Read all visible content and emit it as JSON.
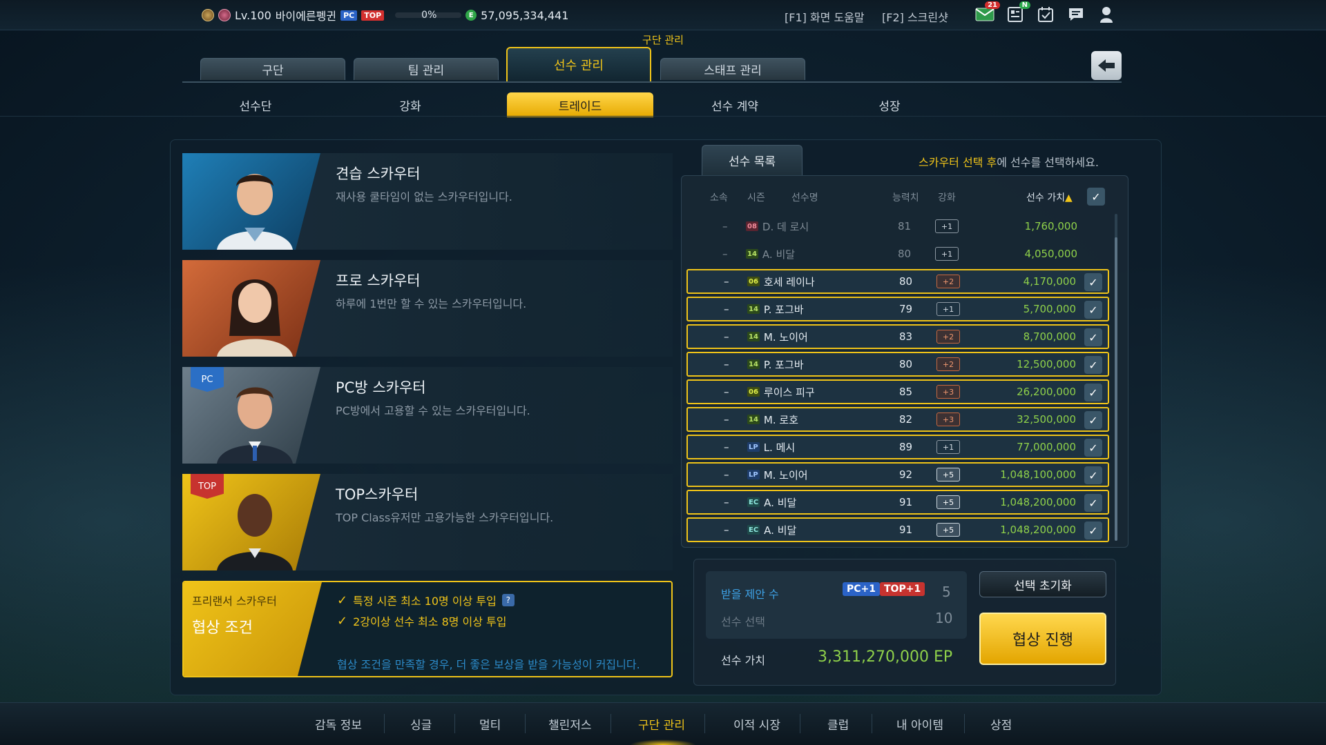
{
  "topbar": {
    "level": "Lv.100",
    "username": "바이에른펭귄",
    "pc_tag": "PC",
    "top_tag": "TOP",
    "exp_percent": "0%",
    "coin_symbol": "E",
    "ep_balance": "57,095,334,441",
    "help": "[F1] 화면 도움말",
    "screenshot": "[F2] 스크린샷",
    "mail_badge": "21",
    "news_badge": "N"
  },
  "header": {
    "section_title": "구단 관리",
    "tabs": [
      {
        "label": "구단"
      },
      {
        "label": "팀 관리"
      },
      {
        "label": "선수 관리"
      },
      {
        "label": "스태프 관리"
      }
    ],
    "active_tab": "선수 관리",
    "subtabs": [
      {
        "label": "선수단"
      },
      {
        "label": "강화"
      },
      {
        "label": "트레이드"
      },
      {
        "label": "선수 계약"
      },
      {
        "label": "성장"
      }
    ],
    "active_subtab": "트레이드"
  },
  "scouts": [
    {
      "name": "견습 스카우터",
      "desc": "재사용 쿨타임이 없는 스카우터입니다.",
      "badge": ""
    },
    {
      "name": "프로 스카우터",
      "desc": "하루에 1번만 할 수 있는 스카우터입니다.",
      "badge": ""
    },
    {
      "name": "PC방 스카우터",
      "desc": "PC방에서 고용할 수 있는 스카우터입니다.",
      "badge": "PC"
    },
    {
      "name": "TOP스카우터",
      "desc": "TOP Class유저만 고용가능한 스카우터입니다.",
      "badge": "TOP"
    }
  ],
  "conditions": {
    "subtitle": "프리랜서 스카우터",
    "title": "협상 조건",
    "items": [
      "특정 시즌 최소 10명 이상 투입",
      "2강이상 선수 최소 8명 이상 투입"
    ],
    "help_icon": "?",
    "note": "협상 조건을 만족할 경우, 더 좋은 보상을 받을 가능성이 커집니다."
  },
  "player_list": {
    "tab": "선수 목록",
    "hint_highlight": "스카우터 선택 후",
    "hint_rest": "에 선수를 선택하세요.",
    "columns": {
      "club": "소속",
      "season": "시즌",
      "name": "선수명",
      "ovr": "능력치",
      "enhance": "강화",
      "value": "선수 가치",
      "sort_arrow": "▲"
    },
    "rows": [
      {
        "club": "–",
        "season": "08",
        "name": "D. 데 로시",
        "ovr": "81",
        "enhance": "+1",
        "value": "1,760,000",
        "selected": false
      },
      {
        "club": "–",
        "season": "14",
        "name": "A. 비달",
        "ovr": "80",
        "enhance": "+1",
        "value": "4,050,000",
        "selected": false
      },
      {
        "club": "–",
        "season": "06",
        "name": "호세 레이나",
        "ovr": "80",
        "enhance": "+2",
        "value": "4,170,000",
        "selected": true
      },
      {
        "club": "–",
        "season": "14",
        "name": "P. 포그바",
        "ovr": "79",
        "enhance": "+1",
        "value": "5,700,000",
        "selected": true
      },
      {
        "club": "–",
        "season": "14",
        "name": "M. 노이어",
        "ovr": "83",
        "enhance": "+2",
        "value": "8,700,000",
        "selected": true
      },
      {
        "club": "–",
        "season": "14",
        "name": "P. 포그바",
        "ovr": "80",
        "enhance": "+2",
        "value": "12,500,000",
        "selected": true
      },
      {
        "club": "–",
        "season": "06",
        "name": "루이스 피구",
        "ovr": "85",
        "enhance": "+3",
        "value": "26,200,000",
        "selected": true
      },
      {
        "club": "–",
        "season": "14",
        "name": "M. 로호",
        "ovr": "82",
        "enhance": "+3",
        "value": "32,500,000",
        "selected": true
      },
      {
        "club": "–",
        "season": "LP",
        "name": "L. 메시",
        "ovr": "89",
        "enhance": "+1",
        "value": "77,000,000",
        "selected": true
      },
      {
        "club": "–",
        "season": "LP",
        "name": "M. 노이어",
        "ovr": "92",
        "enhance": "+5",
        "value": "1,048,100,000",
        "selected": true
      },
      {
        "club": "–",
        "season": "EC",
        "name": "A. 비달",
        "ovr": "91",
        "enhance": "+5",
        "value": "1,048,200,000",
        "selected": true
      },
      {
        "club": "–",
        "season": "EC",
        "name": "A. 비달",
        "ovr": "91",
        "enhance": "+5",
        "value": "1,048,200,000",
        "selected": true
      }
    ]
  },
  "summary": {
    "offer_label": "받을 제안 수",
    "pc_bonus": "PC+1",
    "top_bonus": "TOP+1",
    "offer_count": "5",
    "select_label": "선수 선택",
    "select_count": "10",
    "value_label": "선수 가치",
    "value_total": "3,311,270,000 EP",
    "reset_button": "선택 초기화",
    "negotiate_button": "협상 진행"
  },
  "bottom_nav": {
    "items": [
      "감독 정보",
      "싱글",
      "멀티",
      "챌린저스",
      "구단 관리",
      "이적 시장",
      "클럽",
      "내 아이템",
      "상점"
    ],
    "active": "구단 관리"
  },
  "colors": {
    "accent": "#f0c419",
    "value_green": "#8fd14a",
    "info_blue": "#3ea2e6"
  }
}
